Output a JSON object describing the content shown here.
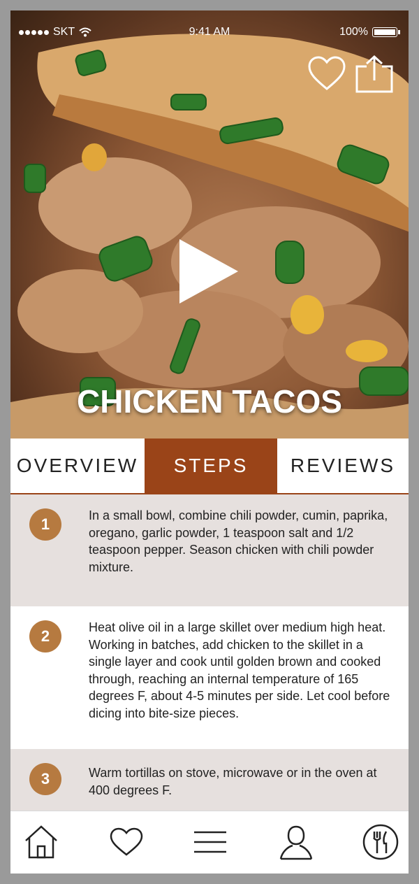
{
  "status": {
    "carrier": "SKT",
    "time": "9:41 AM",
    "battery": "100%"
  },
  "recipe": {
    "title": "CHICKEN TACOS"
  },
  "tabs": [
    {
      "label": "OVERVIEW",
      "active": false
    },
    {
      "label": "STEPS",
      "active": true
    },
    {
      "label": "REVIEWS",
      "active": false
    }
  ],
  "steps": [
    {
      "number": "1",
      "text": "In a small bowl, combine chili powder, cumin, paprika, oregano, garlic powder, 1 teaspoon salt and 1/2 teaspoon pepper. Season chicken with chili powder mixture."
    },
    {
      "number": "2",
      "text": "Heat olive oil  in a large skillet over medium high heat. Working in batches, add chicken to the skillet in a single layer and cook until golden brown and cooked through, reaching an internal temperature of 165 degrees F, about 4-5 minutes per side. Let cool before dicing into bite-size pieces."
    },
    {
      "number": "3",
      "text": "Warm tortillas on stove, microwave or in the oven at 400 degrees F."
    }
  ],
  "icons": {
    "top": [
      "heart-icon",
      "share-icon"
    ],
    "hero": "play-icon",
    "nav": [
      "home-icon",
      "heart-icon",
      "menu-icon",
      "profile-icon",
      "fork-knife-icon"
    ]
  },
  "colors": {
    "accent": "#9a4418",
    "step_badge": "#b67a40",
    "step_bg_alt": "#e6e0de"
  }
}
